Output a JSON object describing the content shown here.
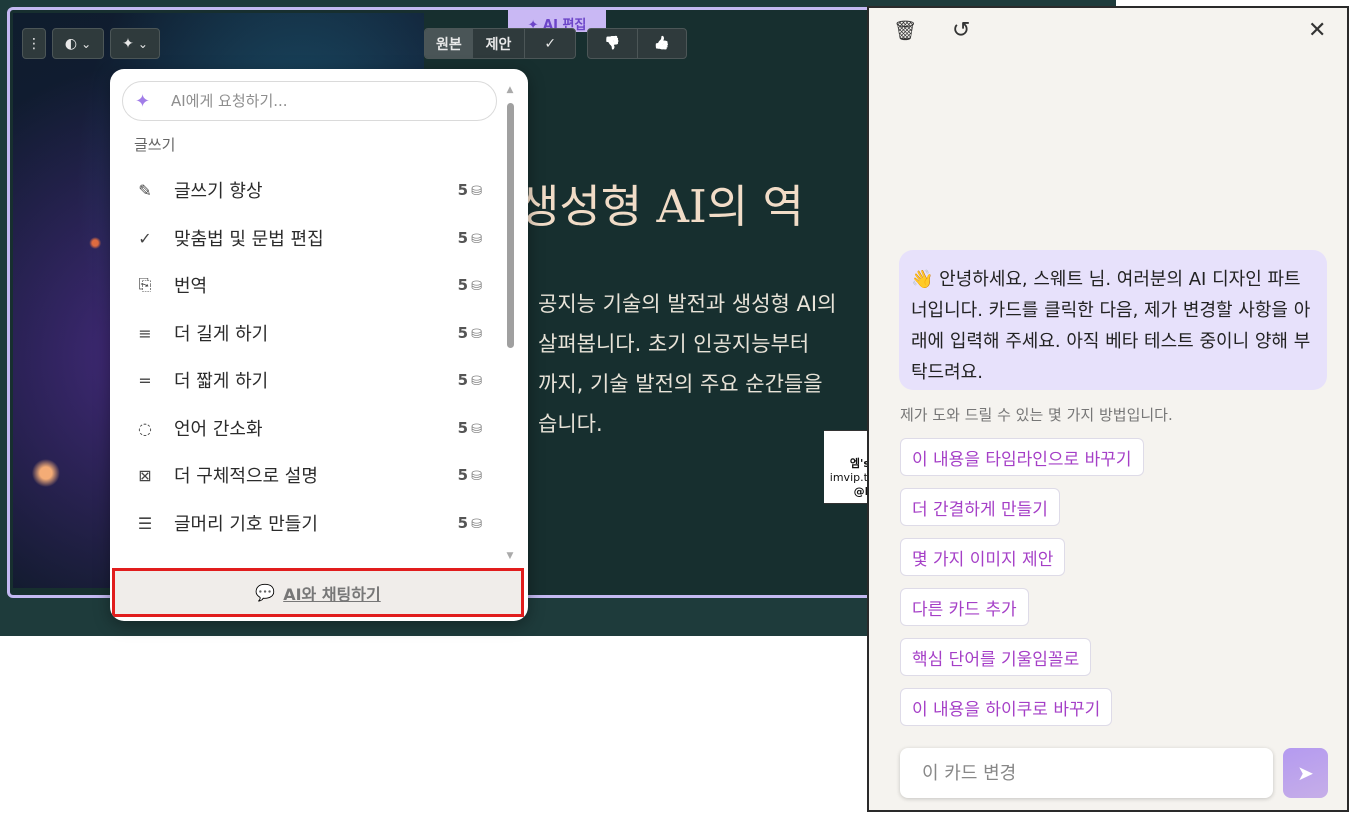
{
  "card": {
    "title": "생성형 AI의 역",
    "body": "공지능 기술의 발전과 생성형 AI의\n 살펴봅니다. 초기 인공지능부터\n까지, 기술 발전의 주요 순간들을\n습니다."
  },
  "toolbar": {
    "menu_icon": "⋮",
    "palette_icon": "◐",
    "chevron_icon": "⌄",
    "sparkle_icon": "✦",
    "ai_edit_label": "✦ AI 편집",
    "original_label": "원본",
    "suggest_label": "제안",
    "check_icon": "✓",
    "thumbs_down_icon": "👎",
    "thumbs_up_icon": "👍"
  },
  "dropdown": {
    "search_placeholder": "AI에게 요청하기...",
    "sparkle_icon": "✦",
    "section_label": "글쓰기",
    "items": [
      {
        "label": "글쓰기 향상",
        "icon": "✎",
        "credits": "5"
      },
      {
        "label": "맞춤법 및 문법 편집",
        "icon": "✓",
        "credits": "5"
      },
      {
        "label": "번역",
        "icon": "⎘",
        "credits": "5"
      },
      {
        "label": "더 길게 하기",
        "icon": "≡",
        "credits": "5"
      },
      {
        "label": "더 짧게 하기",
        "icon": "=",
        "credits": "5"
      },
      {
        "label": "언어 간소화",
        "icon": "◌",
        "credits": "5"
      },
      {
        "label": "더 구체적으로 설명",
        "icon": "⊠",
        "credits": "5"
      },
      {
        "label": "글머리 기호 만들기",
        "icon": "☰",
        "credits": "5"
      }
    ],
    "credit_icon": "⛁",
    "chat_button_label": "AI와 채팅하기",
    "chat_icon": "💬"
  },
  "watermark": {
    "line1": "엠's 블로그",
    "line2": "imvip.tistory.com",
    "line3": "@IMVIP"
  },
  "panel": {
    "delete_icon": "🗑",
    "history_icon": "↺",
    "close_icon": "✕",
    "greeting": "👋 안녕하세요, 스웨트 님. 여러분의 AI 디자인 파트너입니다. 카드를 클릭한 다음, 제가 변경할 사항을 아래에 입력해 주세요. 아직 베타 테스트 중이니 양해 부탁드려요.",
    "hint": "제가 도와 드릴 수 있는 몇 가지 방법입니다.",
    "suggestions": [
      "이 내용을 타임라인으로 바꾸기",
      "더 간결하게 만들기",
      "몇 가지 이미지 제안",
      "다른 카드 추가",
      "핵심 단어를 기울임꼴로",
      "이 내용을 하이쿠로 바꾸기"
    ],
    "input_placeholder": "이 카드 변경",
    "send_icon": "➤"
  }
}
